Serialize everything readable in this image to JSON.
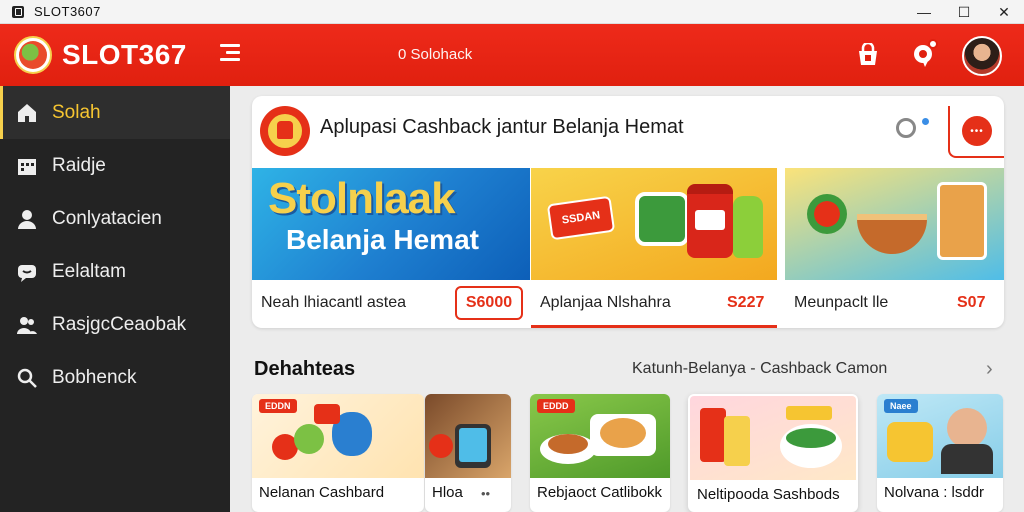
{
  "window": {
    "title": "SLOT3607",
    "controls": {
      "minimize": "—",
      "maximize": "☐",
      "close": "✕"
    }
  },
  "header": {
    "brand": "SLOT367",
    "center_text": "0 Solohack"
  },
  "sidebar": {
    "items": [
      {
        "label": "Solah",
        "icon": "home-icon",
        "active": true
      },
      {
        "label": "Raidje",
        "icon": "building-icon",
        "active": false
      },
      {
        "label": "Conlyatacien",
        "icon": "user-icon",
        "active": false
      },
      {
        "label": "Eelaltam",
        "icon": "chat-icon",
        "active": false
      },
      {
        "label": "RasjgcCeaobak",
        "icon": "people-icon",
        "active": false
      },
      {
        "label": "Bobhenck",
        "icon": "search-icon",
        "active": false
      }
    ]
  },
  "promo": {
    "title": "Aplupasi Cashback jantur Belanja Hemat",
    "banner_big": "Stolnlaak",
    "banner_sub": "Belanja Hemat",
    "banner2_tag": "SSDAN",
    "items": [
      {
        "label": "Neah lhiacantl astea",
        "price": "S6000"
      },
      {
        "label": "Aplanjaa Nlshahra",
        "price": "S227"
      },
      {
        "label": "Meunpaclt lle",
        "price": "S07"
      }
    ]
  },
  "section": {
    "title": "Dehahteas",
    "link": "Katunh-Belanya - Cashback Camon",
    "chevron": "›"
  },
  "cards": [
    {
      "tag": "EDDN",
      "name": "Nelanan Cashbard",
      "more": ""
    },
    {
      "tag": "",
      "name": "Hloa",
      "more": "••"
    },
    {
      "tag": "EDDD",
      "name": "Rebjaoct Catlibokk",
      "more": ""
    },
    {
      "tag": "",
      "name": "Neltipooda Sashbods",
      "more": ""
    },
    {
      "tag": "Naee",
      "name": "Nolvana : lsddr",
      "more": ""
    }
  ],
  "colors": {
    "brand_red": "#e0200f",
    "sidebar_bg": "#232323",
    "accent_yellow": "#f6d04c"
  }
}
